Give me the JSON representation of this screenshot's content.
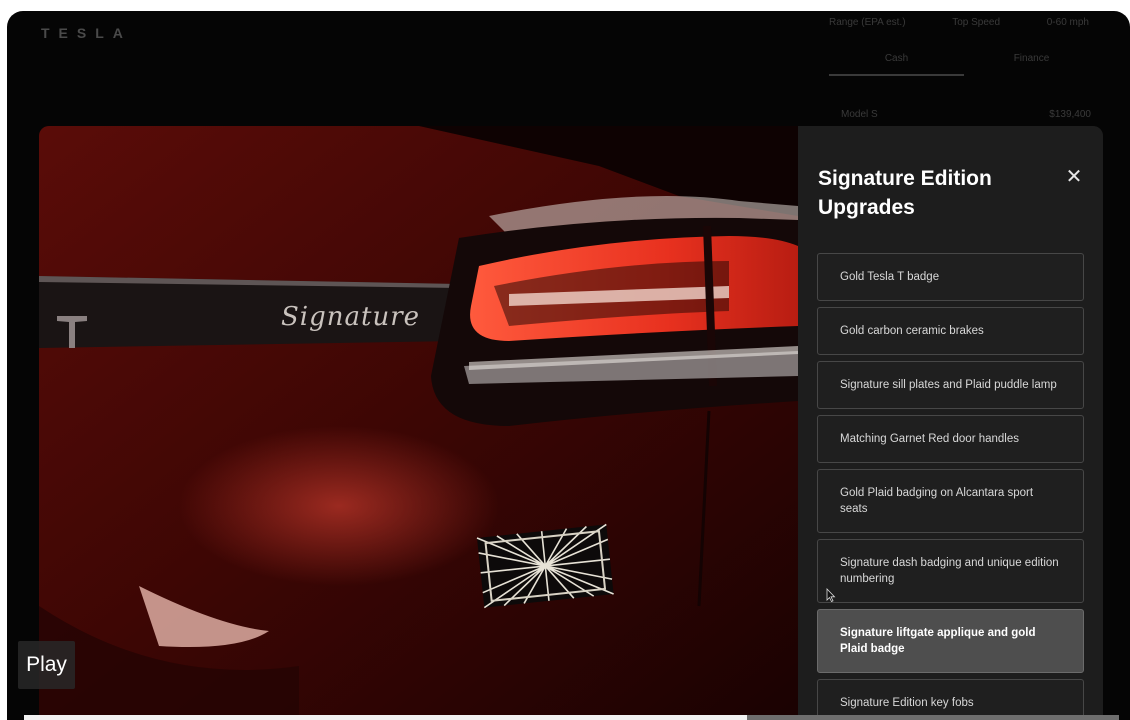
{
  "background_page": {
    "logo": "TESLA",
    "specs": [
      "Range (EPA est.)",
      "Top Speed",
      "0-60 mph"
    ],
    "payment_tabs": [
      "Cash",
      "Finance"
    ],
    "price_row": {
      "label": "Model S",
      "value": "$139,400"
    }
  },
  "modal": {
    "title": "Signature Edition Upgrades",
    "close_label": "✕",
    "media_badge_text": "Signature",
    "upgrades": [
      {
        "label": "Gold Tesla T badge",
        "active": false
      },
      {
        "label": "Gold carbon ceramic brakes",
        "active": false
      },
      {
        "label": "Signature sill plates and Plaid puddle lamp",
        "active": false
      },
      {
        "label": "Matching Garnet Red door handles",
        "active": false
      },
      {
        "label": "Gold Plaid badging on Alcantara sport seats",
        "active": false
      },
      {
        "label": "Signature dash badging and unique edition numbering",
        "active": false
      },
      {
        "label": "Signature liftgate applique and gold Plaid badge",
        "active": true
      },
      {
        "label": "Signature Edition key fobs",
        "active": false
      }
    ]
  },
  "video": {
    "play_label": "Play",
    "progress": 0.66
  },
  "colors": {
    "panel_bg": "#1d1d1d",
    "active_item": "#4e4e4e",
    "car_red": "#7a1410",
    "taillight": "#ff3b2a"
  }
}
